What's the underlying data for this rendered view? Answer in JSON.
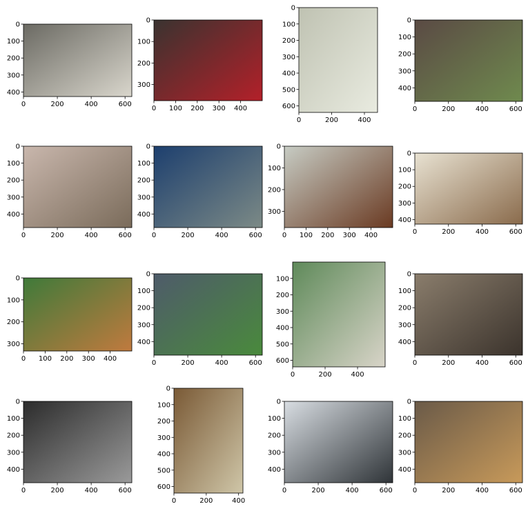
{
  "figure": {
    "panels": [
      {
        "xlim": [
          0,
          640
        ],
        "ylim": [
          0,
          427
        ],
        "xticks": [
          0,
          200,
          400,
          600
        ],
        "yticks": [
          0,
          100,
          200,
          300,
          400
        ],
        "tones": [
          "#6b6a63",
          "#d9d6cc"
        ]
      },
      {
        "xlim": [
          0,
          500
        ],
        "ylim": [
          0,
          375
        ],
        "xticks": [
          0,
          100,
          200,
          300,
          400
        ],
        "yticks": [
          0,
          100,
          200,
          300
        ],
        "tones": [
          "#3a3330",
          "#b32029"
        ]
      },
      {
        "xlim": [
          0,
          480
        ],
        "ylim": [
          0,
          640
        ],
        "xticks": [
          0,
          200,
          400
        ],
        "yticks": [
          0,
          100,
          200,
          300,
          400,
          500,
          600
        ],
        "tones": [
          "#bfc2b2",
          "#e9ebe0"
        ]
      },
      {
        "xlim": [
          0,
          640
        ],
        "ylim": [
          0,
          480
        ],
        "xticks": [
          0,
          200,
          400,
          600
        ],
        "yticks": [
          0,
          100,
          200,
          300,
          400
        ],
        "tones": [
          "#5a4a44",
          "#6f8a4e"
        ]
      },
      {
        "xlim": [
          0,
          640
        ],
        "ylim": [
          0,
          480
        ],
        "xticks": [
          0,
          200,
          400,
          600
        ],
        "yticks": [
          0,
          100,
          200,
          300,
          400
        ],
        "tones": [
          "#c9b7ad",
          "#7a6b5a"
        ]
      },
      {
        "xlim": [
          0,
          640
        ],
        "ylim": [
          0,
          480
        ],
        "xticks": [
          0,
          200,
          400,
          600
        ],
        "yticks": [
          0,
          100,
          200,
          300,
          400
        ],
        "tones": [
          "#1d3f6e",
          "#7c8a86"
        ]
      },
      {
        "xlim": [
          0,
          500
        ],
        "ylim": [
          0,
          375
        ],
        "xticks": [
          0,
          100,
          200,
          300,
          400
        ],
        "yticks": [
          0,
          100,
          200,
          300
        ],
        "tones": [
          "#c7ccc4",
          "#6a3a22"
        ]
      },
      {
        "xlim": [
          0,
          640
        ],
        "ylim": [
          0,
          427
        ],
        "xticks": [
          0,
          200,
          400,
          600
        ],
        "yticks": [
          0,
          100,
          200,
          300,
          400
        ],
        "tones": [
          "#e8e2d2",
          "#8a6b4c"
        ]
      },
      {
        "xlim": [
          0,
          500
        ],
        "ylim": [
          0,
          333
        ],
        "xticks": [
          0,
          100,
          200,
          300,
          400
        ],
        "yticks": [
          0,
          100,
          200,
          300
        ],
        "tones": [
          "#3f7a3a",
          "#c07a3e"
        ]
      },
      {
        "xlim": [
          0,
          640
        ],
        "ylim": [
          0,
          480
        ],
        "xticks": [
          0,
          200,
          400,
          600
        ],
        "yticks": [
          0,
          100,
          200,
          300,
          400
        ],
        "tones": [
          "#4e5b6a",
          "#4a8a3c"
        ]
      },
      {
        "xlim": [
          0,
          570
        ],
        "ylim": [
          0,
          640
        ],
        "xticks": [
          0,
          200,
          400
        ],
        "yticks": [
          100,
          200,
          300,
          400,
          500,
          600
        ],
        "tones": [
          "#5f8a5a",
          "#d8d4c8"
        ]
      },
      {
        "xlim": [
          0,
          640
        ],
        "ylim": [
          0,
          480
        ],
        "xticks": [
          0,
          200,
          400,
          600
        ],
        "yticks": [
          0,
          100,
          200,
          300,
          400
        ],
        "tones": [
          "#8a7d6c",
          "#3b332c"
        ]
      },
      {
        "xlim": [
          0,
          640
        ],
        "ylim": [
          0,
          480
        ],
        "xticks": [
          0,
          200,
          400,
          600
        ],
        "yticks": [
          0,
          100,
          200,
          300,
          400
        ],
        "tones": [
          "#2c2c2c",
          "#9a9a9a"
        ]
      },
      {
        "xlim": [
          0,
          427
        ],
        "ylim": [
          0,
          640
        ],
        "xticks": [
          0,
          200,
          400
        ],
        "yticks": [
          0,
          100,
          200,
          300,
          400,
          500,
          600
        ],
        "tones": [
          "#7a5a36",
          "#cfc6a8"
        ]
      },
      {
        "xlim": [
          0,
          640
        ],
        "ylim": [
          0,
          480
        ],
        "xticks": [
          0,
          200,
          400,
          600
        ],
        "yticks": [
          0,
          100,
          200,
          300,
          400
        ],
        "tones": [
          "#d8dde2",
          "#2f3438"
        ]
      },
      {
        "xlim": [
          0,
          640
        ],
        "ylim": [
          0,
          480
        ],
        "xticks": [
          0,
          200,
          400,
          600
        ],
        "yticks": [
          0,
          100,
          200,
          300,
          400
        ],
        "tones": [
          "#6a5a48",
          "#c89a5a"
        ]
      }
    ]
  }
}
